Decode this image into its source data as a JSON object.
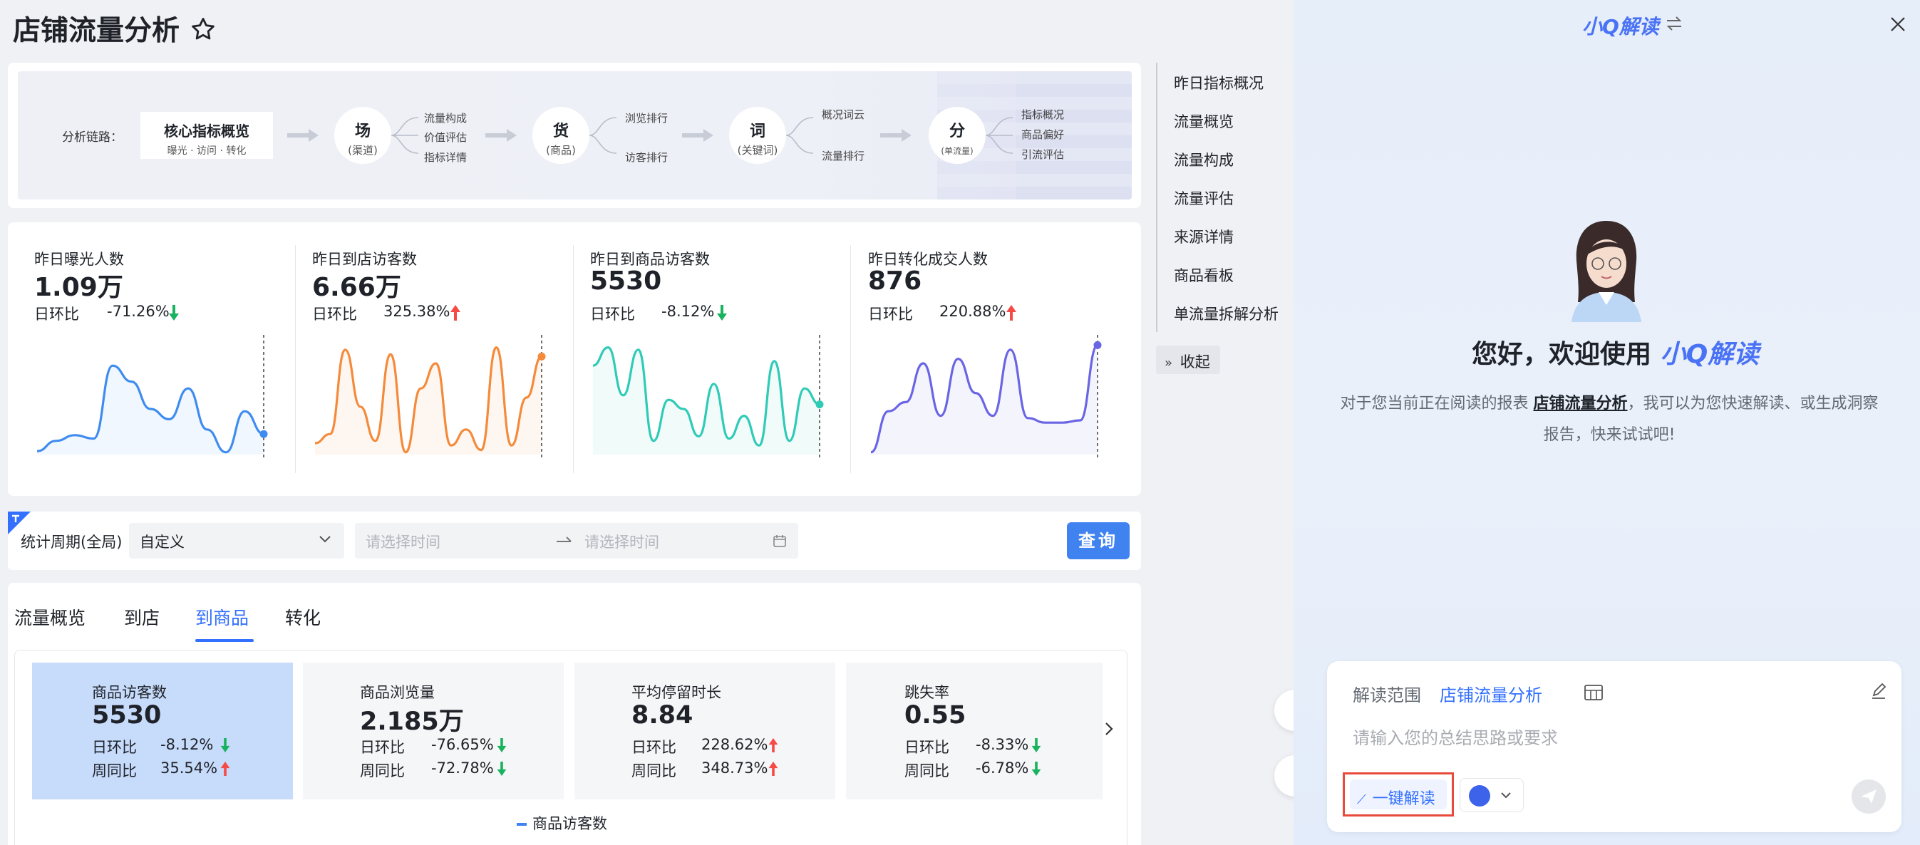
{
  "page": {
    "title": "店铺流量分析"
  },
  "chain": {
    "label": "分析链路：",
    "core": {
      "title": "核心指标概览",
      "sub": "曝光 · 访问 · 转化"
    },
    "nodes": [
      {
        "title": "场",
        "sub": "(渠道)",
        "items": [
          "流量构成",
          "价值评估",
          "指标详情"
        ]
      },
      {
        "title": "货",
        "sub": "(商品)",
        "items": [
          "浏览排行",
          "访客排行"
        ]
      },
      {
        "title": "词",
        "sub": "(关键词)",
        "items": [
          "概况词云",
          "流量排行"
        ]
      },
      {
        "title": "分",
        "sub": "(单流量)",
        "items": [
          "指标概况",
          "商品偏好",
          "引流评估"
        ]
      }
    ]
  },
  "metrics": [
    {
      "title": "昨日曝光人数",
      "value": "1.09万",
      "ratio_label": "日环比",
      "ratio": "-71.26%",
      "dir": "down",
      "color": "#3f8cf0",
      "series": [
        3,
        12,
        17,
        14,
        78,
        64,
        40,
        31,
        58,
        22,
        2,
        38,
        18
      ]
    },
    {
      "title": "昨日到店访客数",
      "value": "6.66万",
      "ratio_label": "日环比",
      "ratio": "325.38%",
      "dir": "up",
      "color": "#f58a3a",
      "series": [
        10,
        18,
        92,
        42,
        12,
        88,
        2,
        58,
        80,
        8,
        22,
        4,
        94,
        8,
        50,
        86
      ]
    },
    {
      "title": "昨日到商品访客数",
      "value": "5530",
      "ratio_label": "日环比",
      "ratio": "-8.12%",
      "dir": "down",
      "color": "#2fcbb7",
      "series": [
        78,
        94,
        52,
        92,
        12,
        48,
        40,
        16,
        62,
        14,
        34,
        8,
        82,
        12,
        58,
        44
      ]
    },
    {
      "title": "昨日转化成交人数",
      "value": "876",
      "ratio_label": "日环比",
      "ratio": "220.88%",
      "dir": "up",
      "color": "#6a65e4",
      "series": [
        2,
        38,
        46,
        80,
        34,
        84,
        54,
        34,
        92,
        32,
        28,
        28,
        30,
        96
      ]
    }
  ],
  "toc": [
    "昨日指标概况",
    "流量概览",
    "流量构成",
    "流量评估",
    "来源详情",
    "商品看板",
    "单流量拆解分析"
  ],
  "toc_collapse": "收起",
  "filter": {
    "label": "统计周期(全局)",
    "select": "自定义",
    "start_placeholder": "请选择时间",
    "end_placeholder": "请选择时间",
    "query": "查询"
  },
  "tabs": [
    "流量概览",
    "到店",
    "到商品",
    "转化"
  ],
  "kpis": [
    {
      "title": "商品访客数",
      "value": "5530",
      "rows": [
        {
          "label": "日环比",
          "value": "-8.12%",
          "dir": "down"
        },
        {
          "label": "周同比",
          "value": "35.54%",
          "dir": "up"
        }
      ]
    },
    {
      "title": "商品浏览量",
      "value": "2.185万",
      "rows": [
        {
          "label": "日环比",
          "value": "-76.65%",
          "dir": "down"
        },
        {
          "label": "周同比",
          "value": "-72.78%",
          "dir": "down"
        }
      ]
    },
    {
      "title": "平均停留时长",
      "value": "8.84",
      "rows": [
        {
          "label": "日环比",
          "value": "228.62%",
          "dir": "up"
        },
        {
          "label": "周同比",
          "value": "348.73%",
          "dir": "up"
        }
      ]
    },
    {
      "title": "跳失率",
      "value": "0.55",
      "rows": [
        {
          "label": "日环比",
          "value": "-8.33%",
          "dir": "down"
        },
        {
          "label": "周同比",
          "value": "-6.78%",
          "dir": "down"
        }
      ]
    }
  ],
  "legend": "商品访客数",
  "panel": {
    "brand": "小Q解读",
    "welcome_prefix": "您好，欢迎使用",
    "welcome_brand": "小Q解读",
    "desc_before": "对于您当前正在阅读的报表",
    "desc_link": "店铺流量分析",
    "desc_after": "，我可以为您快速解读、或生成洞察",
    "desc_line2": "报告，快来试试吧!",
    "scope_label": "解读范围",
    "scope_value": "店铺流量分析",
    "input_placeholder": "请输入您的总结思路或要求",
    "oneclick": "一键解读"
  }
}
